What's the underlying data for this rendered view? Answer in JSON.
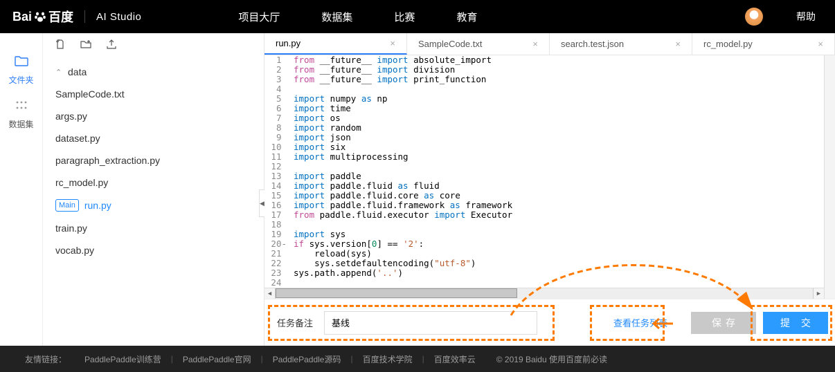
{
  "header": {
    "brand_main": "Bai",
    "brand_sub": "百度",
    "studio": "AI Studio",
    "nav": [
      "项目大厅",
      "数据集",
      "比赛",
      "教育"
    ],
    "help": "帮助"
  },
  "sidebarIcons": {
    "files": "文件夹",
    "datasets": "数据集"
  },
  "fileTree": {
    "folder": "data",
    "files": [
      "SampleCode.txt",
      "args.py",
      "dataset.py",
      "paragraph_extraction.py",
      "rc_model.py"
    ],
    "mainFile": "run.py",
    "mainTag": "Main",
    "tail": [
      "train.py",
      "vocab.py"
    ]
  },
  "tabs": [
    "run.py",
    "SampleCode.txt",
    "search.test.json",
    "rc_model.py"
  ],
  "code": {
    "lines": [
      {
        "n": 1,
        "seg": [
          [
            "from",
            "kw-from"
          ],
          [
            " __future__ ",
            ""
          ],
          [
            "import",
            "kw-imp"
          ],
          [
            " absolute_import",
            ""
          ]
        ]
      },
      {
        "n": 2,
        "seg": [
          [
            "from",
            "kw-from"
          ],
          [
            " __future__ ",
            ""
          ],
          [
            "import",
            "kw-imp"
          ],
          [
            " division",
            ""
          ]
        ]
      },
      {
        "n": 3,
        "seg": [
          [
            "from",
            "kw-from"
          ],
          [
            " __future__ ",
            ""
          ],
          [
            "import",
            "kw-imp"
          ],
          [
            " print_function",
            ""
          ]
        ]
      },
      {
        "n": 4,
        "seg": [
          [
            "",
            ""
          ]
        ]
      },
      {
        "n": 5,
        "seg": [
          [
            "import",
            "kw-imp"
          ],
          [
            " numpy ",
            ""
          ],
          [
            "as",
            "kw-as"
          ],
          [
            " np",
            ""
          ]
        ]
      },
      {
        "n": 6,
        "seg": [
          [
            "import",
            "kw-imp"
          ],
          [
            " time",
            ""
          ]
        ]
      },
      {
        "n": 7,
        "seg": [
          [
            "import",
            "kw-imp"
          ],
          [
            " os",
            ""
          ]
        ]
      },
      {
        "n": 8,
        "seg": [
          [
            "import",
            "kw-imp"
          ],
          [
            " random",
            ""
          ]
        ]
      },
      {
        "n": 9,
        "seg": [
          [
            "import",
            "kw-imp"
          ],
          [
            " json",
            ""
          ]
        ]
      },
      {
        "n": 10,
        "seg": [
          [
            "import",
            "kw-imp"
          ],
          [
            " six",
            ""
          ]
        ]
      },
      {
        "n": 11,
        "seg": [
          [
            "import",
            "kw-imp"
          ],
          [
            " multiprocessing",
            ""
          ]
        ]
      },
      {
        "n": 12,
        "seg": [
          [
            "",
            ""
          ]
        ]
      },
      {
        "n": 13,
        "seg": [
          [
            "import",
            "kw-imp"
          ],
          [
            " paddle",
            ""
          ]
        ]
      },
      {
        "n": 14,
        "seg": [
          [
            "import",
            "kw-imp"
          ],
          [
            " paddle.fluid ",
            ""
          ],
          [
            "as",
            "kw-as"
          ],
          [
            " fluid",
            ""
          ]
        ]
      },
      {
        "n": 15,
        "seg": [
          [
            "import",
            "kw-imp"
          ],
          [
            " paddle.fluid.core ",
            ""
          ],
          [
            "as",
            "kw-as"
          ],
          [
            " core",
            ""
          ]
        ]
      },
      {
        "n": 16,
        "seg": [
          [
            "import",
            "kw-imp"
          ],
          [
            " paddle.fluid.framework ",
            ""
          ],
          [
            "as",
            "kw-as"
          ],
          [
            " framework",
            ""
          ]
        ]
      },
      {
        "n": 17,
        "seg": [
          [
            "from",
            "kw-from"
          ],
          [
            " paddle.fluid.executor ",
            ""
          ],
          [
            "import",
            "kw-imp"
          ],
          [
            " Executor",
            ""
          ]
        ]
      },
      {
        "n": 18,
        "seg": [
          [
            "",
            ""
          ]
        ]
      },
      {
        "n": 19,
        "seg": [
          [
            "import",
            "kw-imp"
          ],
          [
            " sys",
            ""
          ]
        ]
      },
      {
        "n": 20,
        "marker": "-",
        "seg": [
          [
            "if",
            "kw-from"
          ],
          [
            " sys.version[",
            ""
          ],
          [
            "0",
            "num"
          ],
          [
            "] == ",
            ""
          ],
          [
            "'2'",
            "str"
          ],
          [
            ":",
            ""
          ]
        ]
      },
      {
        "n": 21,
        "seg": [
          [
            "    reload(sys)",
            ""
          ]
        ]
      },
      {
        "n": 22,
        "seg": [
          [
            "    sys.setdefaultencoding(",
            ""
          ],
          [
            "\"utf-8\"",
            "str"
          ],
          [
            ")",
            ""
          ]
        ]
      },
      {
        "n": 23,
        "seg": [
          [
            "sys.path.append(",
            ""
          ],
          [
            "'..'",
            "str"
          ],
          [
            ")",
            ""
          ]
        ]
      },
      {
        "n": 24,
        "seg": [
          [
            "",
            ""
          ]
        ]
      }
    ]
  },
  "actionBar": {
    "remarkLabel": "任务备注",
    "remarkValue": "基线",
    "viewTasks": "查看任务列表",
    "save": "保存",
    "submit": "提 交"
  },
  "footer": {
    "label": "友情链接：",
    "links": [
      "PaddlePaddle训练营",
      "PaddlePaddle官网",
      "PaddlePaddle源码",
      "百度技术学院",
      "百度效率云"
    ],
    "copyright": "© 2019 Baidu 使用百度前必读"
  }
}
